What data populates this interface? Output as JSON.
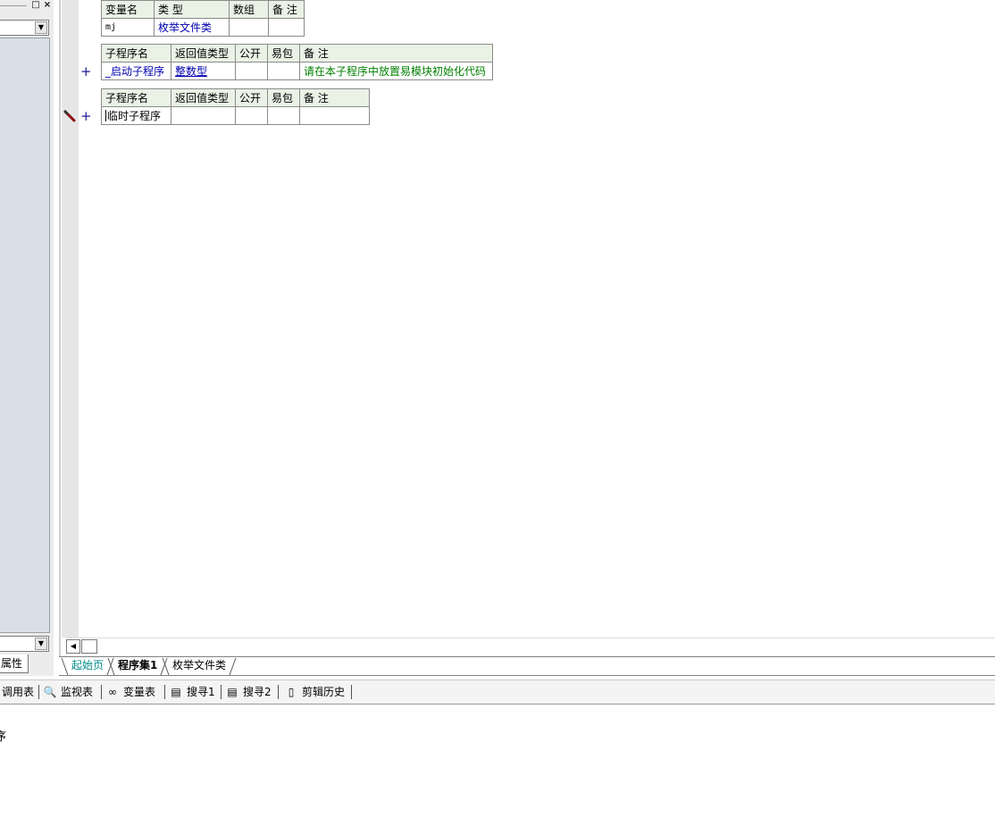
{
  "left_panel": {
    "restore_glyph": "□",
    "close_glyph": "×",
    "dropdown_glyph": "▼",
    "property_tab": "属性"
  },
  "variable_table": {
    "headers": [
      "变量名",
      "类 型",
      "数组",
      "备 注"
    ],
    "rows": [
      {
        "name": "mj",
        "type": "枚举文件类",
        "array": "",
        "note": ""
      }
    ]
  },
  "subroutine_tables": [
    {
      "headers": [
        "子程序名",
        "返回值类型",
        "公开",
        "易包",
        "备 注"
      ],
      "row": {
        "name": "_启动子程序",
        "return_type": "整数型",
        "public": "",
        "easy_pkg": "",
        "note": "请在本子程序中放置易模块初始化代码"
      }
    },
    {
      "headers": [
        "子程序名",
        "返回值类型",
        "公开",
        "易包",
        "备 注"
      ],
      "row": {
        "name": "临时子程序",
        "return_type": "",
        "public": "",
        "easy_pkg": "",
        "note": ""
      }
    }
  ],
  "gutter": {
    "plus_glyph": "+"
  },
  "scrollbar": {
    "left_arrow": "◀"
  },
  "editor_tabs": [
    {
      "label": "起始页",
      "active": false
    },
    {
      "label": "程序集1",
      "active": true
    },
    {
      "label": "枚举文件类",
      "active": false
    }
  ],
  "toolbar": {
    "items": [
      {
        "label": "调用表",
        "icon": ""
      },
      {
        "label": "监视表",
        "icon": "🔍"
      },
      {
        "label": "变量表",
        "icon": "∞"
      },
      {
        "label": "搜寻1",
        "icon": "▤"
      },
      {
        "label": "搜寻2",
        "icon": "▤"
      },
      {
        "label": "剪辑历史",
        "icon": "▯"
      }
    ]
  },
  "output": {
    "text": "序"
  },
  "colors": {
    "header_bg": "#eaf2e6",
    "type_text": "#0000b0",
    "comment_text": "#008000",
    "start_tab_text": "#008a8a",
    "tree_bg": "#d9dfe7"
  }
}
